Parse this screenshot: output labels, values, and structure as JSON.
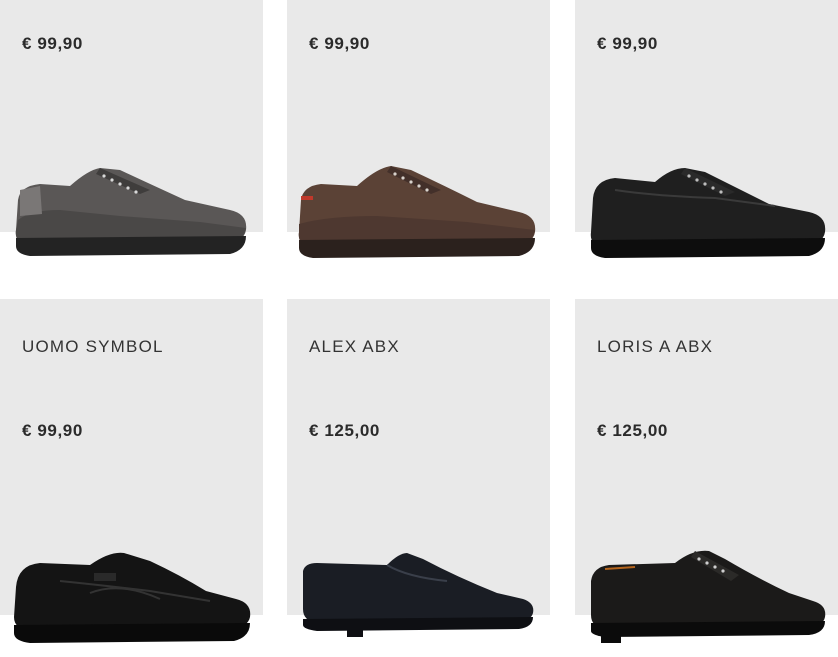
{
  "products_row1": [
    {
      "price": "€ 99,90",
      "image": "grey-suede-sneaker"
    },
    {
      "price": "€ 99,90",
      "image": "brown-suede-sneaker"
    },
    {
      "price": "€ 99,90",
      "image": "black-leather-sneaker"
    }
  ],
  "products_row2": [
    {
      "name": "UOMO SYMBOL",
      "price": "€ 99,90",
      "image": "black-slip-on-sneaker"
    },
    {
      "name": "ALEX ABX",
      "price": "€ 125,00",
      "image": "black-loafer"
    },
    {
      "name": "LORIS A ABX",
      "price": "€ 125,00",
      "image": "black-derby-shoe"
    }
  ],
  "colors": {
    "card_bg": "#e9e9e9",
    "text": "#333333"
  }
}
